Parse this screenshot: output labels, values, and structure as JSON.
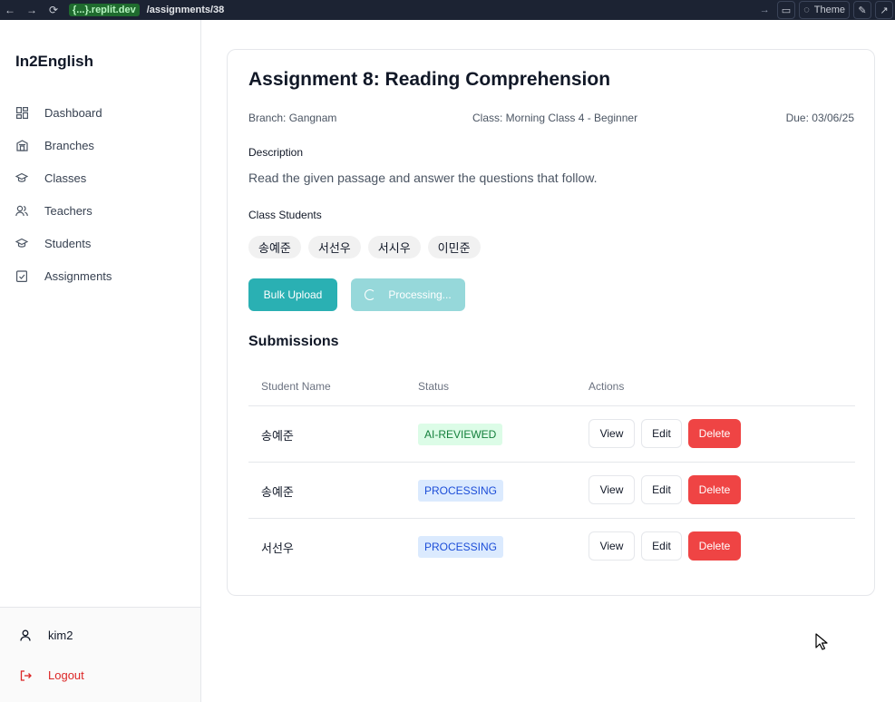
{
  "browser": {
    "url_host": "{...}.replit.dev",
    "url_path": "/assignments/38",
    "theme_label": "Theme"
  },
  "sidebar": {
    "brand": "In2English",
    "items": [
      {
        "label": "Dashboard",
        "icon": "dashboard-icon"
      },
      {
        "label": "Branches",
        "icon": "building-icon"
      },
      {
        "label": "Classes",
        "icon": "graduation-cap-icon"
      },
      {
        "label": "Teachers",
        "icon": "users-icon"
      },
      {
        "label": "Students",
        "icon": "graduation-cap-icon"
      },
      {
        "label": "Assignments",
        "icon": "clipboard-check-icon"
      }
    ],
    "user": "kim2",
    "logout": "Logout"
  },
  "assignment": {
    "title": "Assignment 8: Reading Comprehension",
    "branch": "Branch: Gangnam",
    "class": "Class: Morning Class 4 - Beginner",
    "due": "Due: 03/06/25",
    "description_label": "Description",
    "description": "Read the given passage and answer the questions that follow.",
    "students_label": "Class Students",
    "students": [
      "송예준",
      "서선우",
      "서시우",
      "이민준"
    ],
    "bulk_upload_label": "Bulk Upload",
    "processing_label": "Processing..."
  },
  "submissions": {
    "title": "Submissions",
    "columns": [
      "Student Name",
      "Status",
      "Actions"
    ],
    "rows": [
      {
        "name": "송예준",
        "status": "AI-REVIEWED"
      },
      {
        "name": "송예준",
        "status": "PROCESSING"
      },
      {
        "name": "서선우",
        "status": "PROCESSING"
      }
    ],
    "view_label": "View",
    "edit_label": "Edit",
    "delete_label": "Delete"
  },
  "colors": {
    "primary": "#2ab0b3",
    "danger": "#ef4444",
    "reviewed_bg": "#dcfce7",
    "processing_bg": "#dbeafe"
  }
}
